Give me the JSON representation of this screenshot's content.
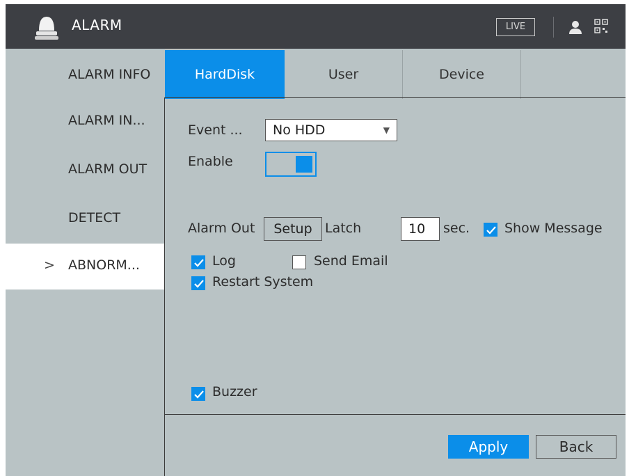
{
  "header": {
    "title": "ALARM",
    "live_label": "LIVE",
    "icons": [
      "alarm-bell-icon",
      "user-icon",
      "qr-code-icon"
    ]
  },
  "sidebar": {
    "items": [
      {
        "label": "ALARM INFO"
      },
      {
        "label": "ALARM IN..."
      },
      {
        "label": "ALARM OUT"
      },
      {
        "label": "DETECT"
      },
      {
        "label": "ABNORM...",
        "active": true,
        "chevron": ">"
      }
    ]
  },
  "tabs": [
    {
      "label": "HardDisk",
      "active": true
    },
    {
      "label": "User"
    },
    {
      "label": "Device"
    }
  ],
  "form": {
    "event_type_label": "Event ...",
    "event_type_value": "No HDD",
    "enable_label": "Enable",
    "enable_on": true,
    "alarm_out_label": "Alarm Out",
    "setup_label": "Setup",
    "latch_label": "Latch",
    "latch_value": "10",
    "latch_unit": "sec.",
    "show_message_label": "Show Message",
    "show_message_checked": true,
    "log_label": "Log",
    "log_checked": true,
    "send_email_label": "Send Email",
    "send_email_checked": false,
    "restart_system_label": "Restart System",
    "restart_system_checked": true,
    "buzzer_label": "Buzzer",
    "buzzer_checked": true
  },
  "footer": {
    "apply_label": "Apply",
    "back_label": "Back"
  },
  "colors": {
    "accent": "#0b8ee9",
    "header_bg": "#3d3f44",
    "panel_bg": "#b9c3c5"
  }
}
